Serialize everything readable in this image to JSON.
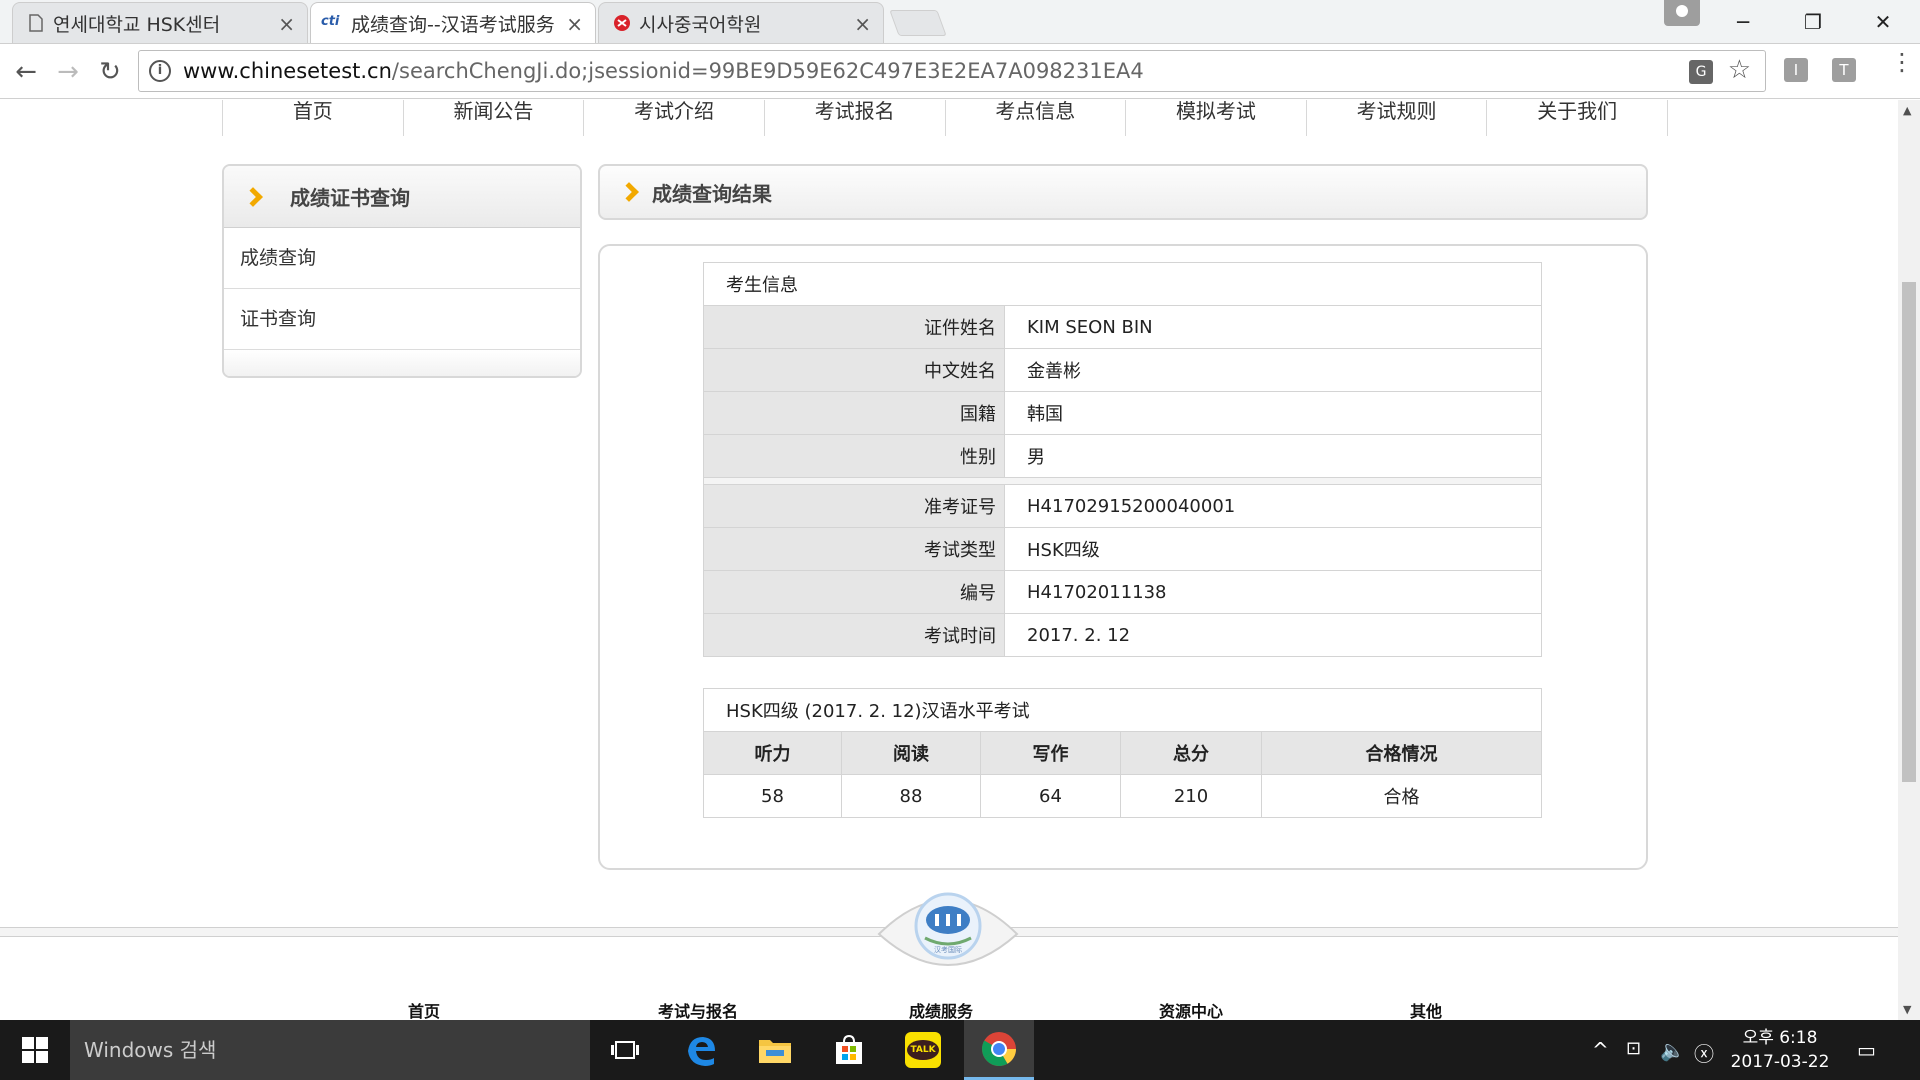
{
  "browser": {
    "tabs": [
      {
        "title": "연세대학교 HSK센터",
        "active": false
      },
      {
        "title": "成绩查询--汉语考试服务",
        "active": true
      },
      {
        "title": "시사중국어학원",
        "active": false
      }
    ],
    "favicon_text": "cti",
    "url_host": "www.chinesetest.cn",
    "url_path": "/searchChengJi.do;jsessionid=99BE9D59E62C497E3E2EA7A098231EA4",
    "ext_labels": [
      "I",
      "T"
    ]
  },
  "nav": [
    "首页",
    "新闻公告",
    "考试介绍",
    "考试报名",
    "考点信息",
    "模拟考试",
    "考试规则",
    "关于我们"
  ],
  "sidebar": {
    "title": "成绩证书查询",
    "items": [
      "成绩查询",
      "证书查询"
    ]
  },
  "result": {
    "title": "成绩查询结果",
    "info_caption": "考生信息",
    "info_rows": [
      {
        "label": "证件姓名",
        "value": "KIM SEON BIN"
      },
      {
        "label": "中文姓名",
        "value": "金善彬"
      },
      {
        "label": "国籍",
        "value": "韩国"
      },
      {
        "label": "性别",
        "value": "男"
      },
      {
        "label": "准考证号",
        "value": "H41702915200040001"
      },
      {
        "label": "考试类型",
        "value": "HSK四级"
      },
      {
        "label": "编号",
        "value": "H41702011138"
      },
      {
        "label": "考试时间",
        "value": "2017. 2. 12"
      }
    ],
    "score_caption": "HSK四级 (2017. 2. 12)汉语水平考试",
    "score_headers": [
      "听力",
      "阅读",
      "写作",
      "总分",
      "合格情况"
    ],
    "score_values": [
      "58",
      "88",
      "64",
      "210",
      "合格"
    ]
  },
  "footer": {
    "links": [
      "首页",
      "考试与报名",
      "成绩服务",
      "资源中心",
      "其他"
    ],
    "emblem_text": "汉考国际"
  },
  "taskbar": {
    "search_placeholder": "Windows 검색",
    "time": "오후 6:18",
    "date": "2017-03-22",
    "kakao_label": "TALK"
  },
  "colors": {
    "accent_chevron": "#f2a900",
    "label_bg": "#e6e6e6",
    "taskbar_bg": "#1a1a1a"
  }
}
